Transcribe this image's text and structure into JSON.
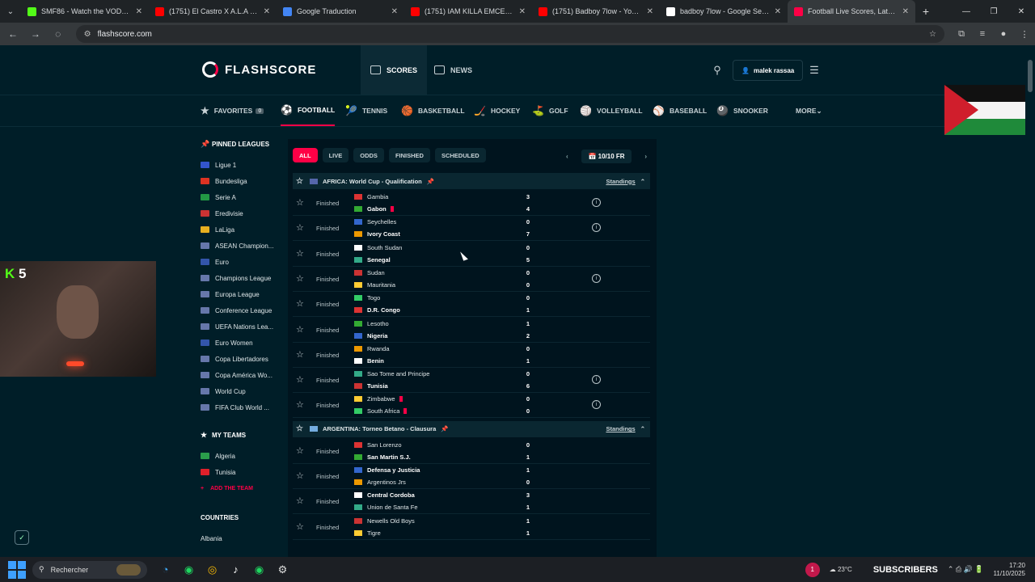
{
  "browser": {
    "tabs": [
      {
        "title": "SMF86 - Watch the VOD on Kic",
        "color": "#53fc18"
      },
      {
        "title": "(1751) El Castro X A.L.A : M",
        "color": "#ff0000"
      },
      {
        "title": "Google Traduction",
        "color": "#4285f4"
      },
      {
        "title": "(1751) IAM KILLA EMCEE - You",
        "color": "#ff0000"
      },
      {
        "title": "(1751) Badboy 7low - YouTube",
        "color": "#ff0000"
      },
      {
        "title": "badboy 7low - Google Search",
        "color": "#ffffff"
      },
      {
        "title": "Football Live Scores, Latest Foo",
        "color": "#ff0046"
      }
    ],
    "url": "flashscore.com"
  },
  "site": {
    "logo": "FLASHSCORE",
    "nav": {
      "scores": "SCORES",
      "news": "NEWS"
    },
    "user": "malek rassaa"
  },
  "sports": [
    {
      "label": "FAVORITES",
      "icon": "★",
      "count": "0"
    },
    {
      "label": "FOOTBALL",
      "icon": "⚽"
    },
    {
      "label": "TENNIS",
      "icon": "🎾"
    },
    {
      "label": "BASKETBALL",
      "icon": "🏀"
    },
    {
      "label": "HOCKEY",
      "icon": "🏒"
    },
    {
      "label": "GOLF",
      "icon": "⛳"
    },
    {
      "label": "VOLLEYBALL",
      "icon": "🏐"
    },
    {
      "label": "BASEBALL",
      "icon": "⚾"
    },
    {
      "label": "SNOOKER",
      "icon": "🎱"
    },
    {
      "label": "MORE",
      "icon": ""
    }
  ],
  "sidebar": {
    "pinned_title": "PINNED LEAGUES",
    "pinned": [
      {
        "name": "Ligue 1",
        "color": "#3355cc"
      },
      {
        "name": "Bundesliga",
        "color": "#dd3322"
      },
      {
        "name": "Serie A",
        "color": "#229944"
      },
      {
        "name": "Eredivisie",
        "color": "#cc3333"
      },
      {
        "name": "LaLiga",
        "color": "#e8b020"
      },
      {
        "name": "ASEAN Champion...",
        "color": "#6677aa"
      },
      {
        "name": "Euro",
        "color": "#3355aa"
      },
      {
        "name": "Champions League",
        "color": "#6677aa"
      },
      {
        "name": "Europa League",
        "color": "#6677aa"
      },
      {
        "name": "Conference League",
        "color": "#6677aa"
      },
      {
        "name": "UEFA Nations Lea...",
        "color": "#6677aa"
      },
      {
        "name": "Euro Women",
        "color": "#3355aa"
      },
      {
        "name": "Copa Libertadores",
        "color": "#6677aa"
      },
      {
        "name": "Copa América Wo...",
        "color": "#6677aa"
      },
      {
        "name": "World Cup",
        "color": "#6677aa"
      },
      {
        "name": "FIFA Club World ...",
        "color": "#6677aa"
      }
    ],
    "teams_title": "MY TEAMS",
    "teams": [
      {
        "name": "Algeria",
        "color": "#2a9d4b"
      },
      {
        "name": "Tunisia",
        "color": "#e0202a"
      }
    ],
    "add_team": "ADD THE TEAM",
    "countries_title": "COUNTRIES",
    "countries": [
      {
        "name": "Albania"
      }
    ]
  },
  "filters": [
    "ALL",
    "LIVE",
    "ODDS",
    "FINISHED",
    "SCHEDULED"
  ],
  "date": "10/10 FR",
  "leagues": [
    {
      "name": "AFRICA: World Cup - Qualification",
      "standings": "Standings",
      "matches": [
        {
          "status": "Finished",
          "home": "Gambia",
          "away": "Gabon",
          "hs": "3",
          "as": "4",
          "winner": "away",
          "away_red": true,
          "info": true
        },
        {
          "status": "Finished",
          "home": "Seychelles",
          "away": "Ivory Coast",
          "hs": "0",
          "as": "7",
          "winner": "away",
          "info": true
        },
        {
          "status": "Finished",
          "home": "South Sudan",
          "away": "Senegal",
          "hs": "0",
          "as": "5",
          "winner": "away"
        },
        {
          "status": "Finished",
          "home": "Sudan",
          "away": "Mauritania",
          "hs": "0",
          "as": "0",
          "winner": "",
          "info": true
        },
        {
          "status": "Finished",
          "home": "Togo",
          "away": "D.R. Congo",
          "hs": "0",
          "as": "1",
          "winner": "away"
        },
        {
          "status": "Finished",
          "home": "Lesotho",
          "away": "Nigeria",
          "hs": "1",
          "as": "2",
          "winner": "away"
        },
        {
          "status": "Finished",
          "home": "Rwanda",
          "away": "Benin",
          "hs": "0",
          "as": "1",
          "winner": "away"
        },
        {
          "status": "Finished",
          "home": "Sao Tome and Principe",
          "away": "Tunisia",
          "hs": "0",
          "as": "6",
          "winner": "away",
          "info": true
        },
        {
          "status": "Finished",
          "home": "Zimbabwe",
          "away": "South Africa",
          "hs": "0",
          "as": "0",
          "winner": "",
          "home_red": true,
          "away_red": true,
          "info": true
        }
      ]
    },
    {
      "name": "ARGENTINA: Torneo Betano - Clausura",
      "standings": "Standings",
      "matches": [
        {
          "status": "Finished",
          "home": "San Lorenzo",
          "away": "San Martin S.J.",
          "hs": "0",
          "as": "1",
          "winner": "away"
        },
        {
          "status": "Finished",
          "home": "Defensa y Justicia",
          "away": "Argentinos Jrs",
          "hs": "1",
          "as": "0",
          "winner": "home"
        },
        {
          "status": "Finished",
          "home": "Central Cordoba",
          "away": "Union de Santa Fe",
          "hs": "3",
          "as": "1",
          "winner": "home"
        },
        {
          "status": "Finished",
          "home": "Newells Old Boys",
          "away": "Tigre",
          "hs": "1",
          "as": "1",
          "winner": ""
        }
      ]
    }
  ],
  "overlay": {
    "kick_count": "5"
  },
  "taskbar": {
    "search": "Rechercher",
    "notif": "1",
    "weather": "23°C",
    "subscribers": "SUBSCRIBERS",
    "time": "17:20",
    "date": "11/10/2025"
  }
}
